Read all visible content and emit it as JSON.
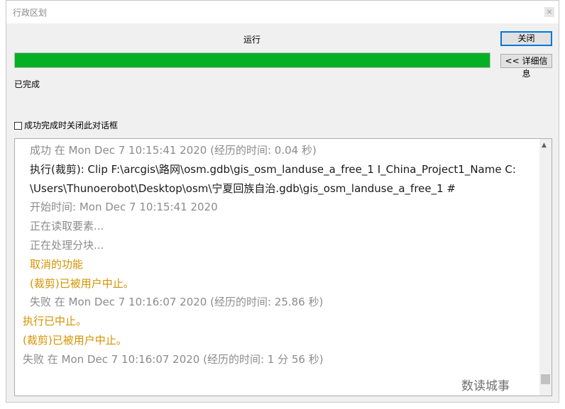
{
  "window": {
    "title": "行政区划",
    "close_glyph": "×"
  },
  "status": {
    "running_label": "运行",
    "completed_label": "已完成",
    "progress": 1.0
  },
  "buttons": {
    "close_label": "关闭",
    "details_label": "<< 详细信息"
  },
  "checkbox": {
    "label": "成功完成时关闭此对话框",
    "checked": false
  },
  "log": [
    {
      "text": "成功 在 Mon Dec  7 10:15:41 2020 (经历的时间: 0.04 秒)",
      "style": "gray"
    },
    {
      "text": "执行(裁剪): Clip F:\\arcgis\\路网\\osm.gdb\\gis_osm_landuse_a_free_1 I_China_Project1_Name C:",
      "style": "black"
    },
    {
      "text": "\\Users\\Thunoerobot\\Desktop\\osm\\宁夏回族自治.gdb\\gis_osm_landuse_a_free_1 #",
      "style": "black"
    },
    {
      "text": "开始时间: Mon Dec  7 10:15:41 2020",
      "style": "gray"
    },
    {
      "text": "正在读取要素...",
      "style": "gray"
    },
    {
      "text": "正在处理分块...",
      "style": "gray"
    },
    {
      "text": "取消的功能",
      "style": "orange"
    },
    {
      "text": "(裁剪)已被用户中止。",
      "style": "orange"
    },
    {
      "text": "失败 在 Mon Dec  7 10:16:07 2020 (经历的时间: 25.86 秒)",
      "style": "gray"
    },
    {
      "text": "执行已中止。",
      "style": "orange"
    },
    {
      "text": "(裁剪)已被用户中止。",
      "style": "orange"
    },
    {
      "text": "失败 在 Mon Dec  7 10:16:07 2020 (经历的时间: 1 分 56 秒)",
      "style": "gray"
    }
  ],
  "watermark": "数读城事",
  "colors": {
    "progress_fill": "#06b025",
    "warning_text": "#d49300",
    "muted_text": "#8c8c8c"
  }
}
